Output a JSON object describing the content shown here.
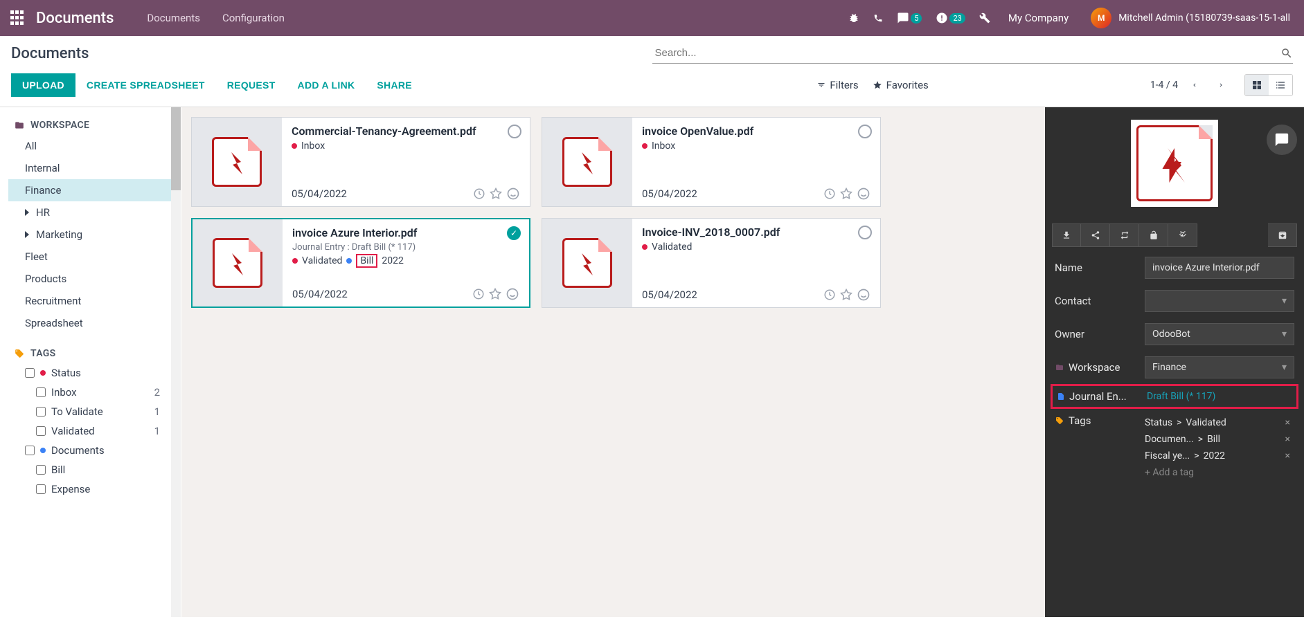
{
  "topbar": {
    "app_title": "Documents",
    "nav": {
      "documents": "Documents",
      "configuration": "Configuration"
    },
    "msg_badge": "5",
    "activity_badge": "23",
    "company": "My Company",
    "user": "Mitchell Admin (15180739-saas-15-1-all"
  },
  "controls": {
    "heading": "Documents",
    "search_placeholder": "Search...",
    "upload": "UPLOAD",
    "create_spreadsheet": "CREATE SPREADSHEET",
    "request": "REQUEST",
    "add_link": "ADD A LINK",
    "share": "SHARE",
    "filters": "Filters",
    "favorites": "Favorites",
    "pager": "1-4 / 4"
  },
  "sidebar": {
    "workspace_header": "WORKSPACE",
    "ws": {
      "all": "All",
      "internal": "Internal",
      "finance": "Finance",
      "hr": "HR",
      "marketing": "Marketing",
      "fleet": "Fleet",
      "products": "Products",
      "recruitment": "Recruitment",
      "spreadsheet": "Spreadsheet"
    },
    "tags_header": "TAGS",
    "tags": {
      "status": "Status",
      "inbox": "Inbox",
      "inbox_count": "2",
      "to_validate": "To Validate",
      "to_validate_count": "1",
      "validated": "Validated",
      "validated_count": "1",
      "documents": "Documents",
      "bill": "Bill",
      "expense": "Expense"
    }
  },
  "cards": [
    {
      "title": "Commercial-Tenancy-Agreement.pdf",
      "tags": [
        {
          "color": "#e11d48",
          "label": "Inbox"
        }
      ],
      "date": "05/04/2022",
      "selected": false
    },
    {
      "title": "invoice OpenValue.pdf",
      "tags": [
        {
          "color": "#e11d48",
          "label": "Inbox"
        }
      ],
      "date": "05/04/2022",
      "selected": false
    },
    {
      "title": "invoice Azure Interior.pdf",
      "sub": "Journal Entry : Draft Bill (* 117)",
      "tags": [
        {
          "color": "#e11d48",
          "label": "Validated"
        },
        {
          "color": "#3b82f6",
          "label": "Bill",
          "boxed": true
        },
        {
          "color": "",
          "label": "2022"
        }
      ],
      "date": "05/04/2022",
      "selected": true
    },
    {
      "title": "Invoice-INV_2018_0007.pdf",
      "tags": [
        {
          "color": "#e11d48",
          "label": "Validated"
        }
      ],
      "date": "05/04/2022",
      "selected": false
    }
  ],
  "details": {
    "name_label": "Name",
    "name": "invoice Azure Interior.pdf",
    "contact_label": "Contact",
    "contact": "",
    "owner_label": "Owner",
    "owner": "OdooBot",
    "workspace_label": "Workspace",
    "workspace": "Finance",
    "journal_label": "Journal En...",
    "journal_value": "Draft Bill (* 117)",
    "tags_label": "Tags",
    "tag_rows": [
      {
        "group": "Status",
        "sep": " > ",
        "value": "Validated"
      },
      {
        "group": "Documen...",
        "sep": " > ",
        "value": "Bill"
      },
      {
        "group": "Fiscal ye...",
        "sep": " > ",
        "value": "2022"
      }
    ],
    "add_tag": "+ Add a tag"
  }
}
